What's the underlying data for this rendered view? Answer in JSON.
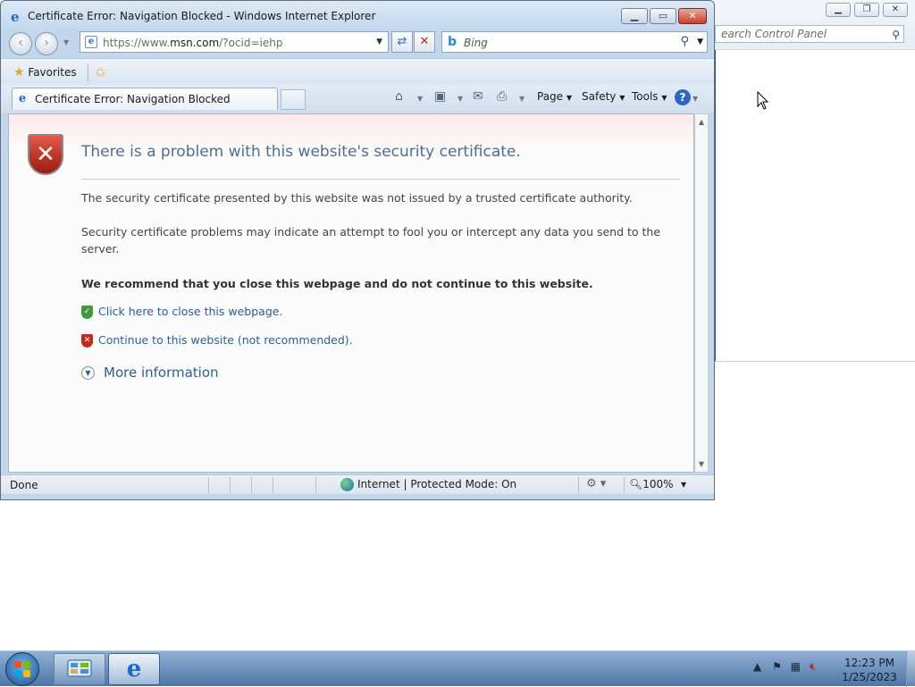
{
  "window": {
    "title": "Certificate Error: Navigation Blocked - Windows Internet Explorer",
    "icon": "ie-logo-icon",
    "address": {
      "url_prefix": "https://www.",
      "url_domain": "msn.com",
      "url_suffix": "/?ocid=iehp"
    },
    "search": {
      "placeholder": "Bing"
    }
  },
  "favorites_bar": {
    "favorites_label": "Favorites"
  },
  "tab": {
    "label": "Certificate Error: Navigation Blocked"
  },
  "command_bar": {
    "page_label": "Page",
    "safety_label": "Safety",
    "tools_label": "Tools",
    "help_glyph": "?"
  },
  "error_page": {
    "heading": "There is a problem with this website's security certificate.",
    "paragraph1": "The security certificate presented by this website was not issued by a trusted certificate authority.",
    "paragraph2": "Security certificate problems may indicate an attempt to fool you or intercept any data you send to the server.",
    "recommendation": "We recommend that you close this webpage and do not continue to this website.",
    "close_link": "Click here to close this webpage.",
    "continue_link": "Continue to this website (not recommended).",
    "more_info": "More information"
  },
  "status_bar": {
    "status": "Done",
    "zone": "Internet | Protected Mode: On",
    "zoom": "100%"
  },
  "background_window": {
    "search_placeholder": "earch Control Panel"
  },
  "taskbar": {
    "time": "12:23 PM",
    "date": "1/25/2023"
  },
  "colors": {
    "link": "#2b5f93",
    "heading": "#4f6e8e",
    "shield_red": "#c42b1c",
    "shield_green": "#3e9a3a"
  }
}
